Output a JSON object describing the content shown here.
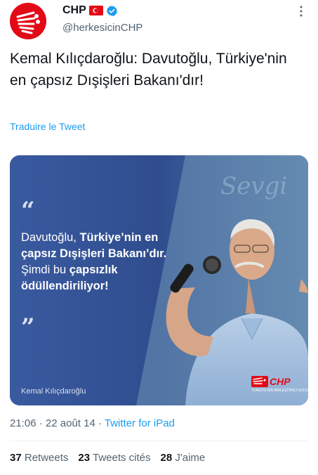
{
  "author": {
    "display_name": "CHP",
    "handle": "@herkesicinCHP",
    "verified": true,
    "avatar_color": "#e30a17"
  },
  "tweet": {
    "text": "Kemal Kılıçdaroğlu: Davutoğlu, Türkiye'nin en çapsız Dışişleri Bakanı'dır!",
    "translate_label": "Traduire le Tweet"
  },
  "media": {
    "quote_open": "“",
    "quote_close": "”",
    "quote_part1": "Davutoğlu, ",
    "quote_part2": "Türkiye’nin en çapsız Dışişleri Bakanı’dır.",
    "quote_part3": " Şimdi bu ",
    "quote_part4": "çapsızlık ödüllendiriliyor!",
    "caption": "Kemal Kılıçdaroğlu",
    "badge_logo": "CHP",
    "badge_motto": "TÜRKİYE'NİN BİRLEŞTİRİCİ GÜCÜ"
  },
  "meta": {
    "time": "21:06",
    "separator1": " · ",
    "date": "22 août 14",
    "separator2": " · ",
    "source": "Twitter for iPad"
  },
  "stats": {
    "retweets_count": "37",
    "retweets_label": "Retweets",
    "quotes_count": "23",
    "quotes_label": "Tweets cités",
    "likes_count": "28",
    "likes_label": "J'aime"
  },
  "colors": {
    "link": "#1d9bf0",
    "secondary_text": "#536471",
    "brand_red": "#e30a17"
  },
  "icons": [
    "chp-logo-icon",
    "turkey-flag-icon",
    "verified-badge-icon",
    "more-options-icon"
  ]
}
